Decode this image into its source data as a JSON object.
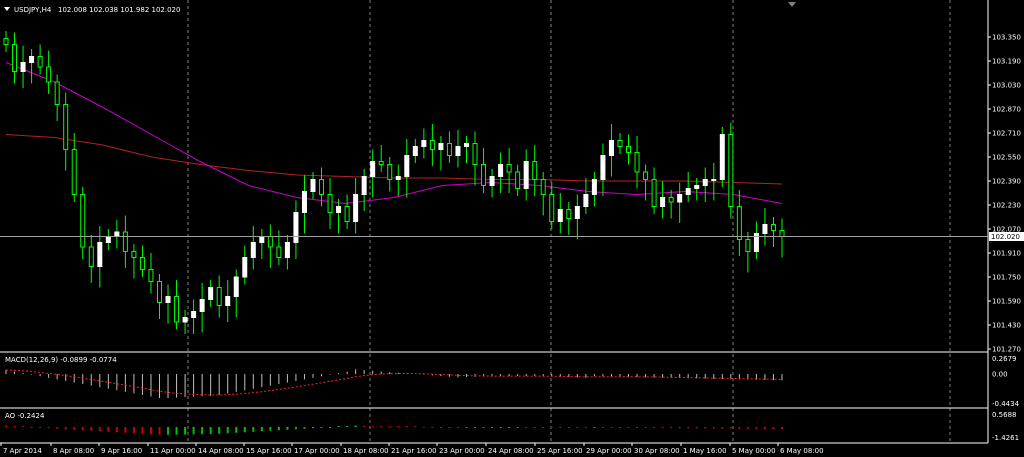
{
  "header": {
    "symbol_label": "USDJPY,H4",
    "ohlc": "102.008 102.038 101.982 102.020"
  },
  "price_panel": {
    "current_price_label": "102.020"
  },
  "macd_panel": {
    "label": "MACD(12,26,9) -0.0899 -0.0774"
  },
  "ao_panel": {
    "label": "AO -0.2424"
  },
  "colors": {
    "background": "#000000",
    "bull_candle": "#ffffff",
    "candle_wick": "#00ff00",
    "ma_fast": "#cc00cc",
    "ma_slow": "#b22222",
    "macd_hist": "#c0c0c0",
    "macd_signal": "#ff2020",
    "ao_up": "#00c000",
    "ao_down": "#d00000"
  },
  "chart_data": [
    {
      "type": "candlestick",
      "title": "USDJPY,H4",
      "y_ticks": [
        "103.350",
        "103.190",
        "103.030",
        "102.870",
        "102.710",
        "102.550",
        "102.390",
        "102.230",
        "102.070",
        "101.910",
        "101.750",
        "101.590",
        "101.430",
        "101.270"
      ],
      "x_ticks": [
        "7 Apr 2014",
        "8 Apr 08:00",
        "9 Apr 16:00",
        "11 Apr 00:00",
        "14 Apr 08:00",
        "15 Apr 16:00",
        "17 Apr 00:00",
        "18 Apr 08:00",
        "21 Apr 16:00",
        "23 Apr 00:00",
        "24 Apr 08:00",
        "25 Apr 16:00",
        "29 Apr 00:00",
        "30 Apr 08:00",
        "1 May 16:00",
        "5 May 00:00",
        "6 May 08:00"
      ],
      "ylim": [
        101.27,
        103.43
      ],
      "closes": [
        103.3,
        103.12,
        103.18,
        103.22,
        103.15,
        103.05,
        102.9,
        102.6,
        102.3,
        101.95,
        101.82,
        101.98,
        102.02,
        102.05,
        101.92,
        101.88,
        101.8,
        101.72,
        101.58,
        101.62,
        101.45,
        101.48,
        101.52,
        101.6,
        101.68,
        101.56,
        101.62,
        101.75,
        101.88,
        101.98,
        102.02,
        101.95,
        101.88,
        101.98,
        102.18,
        102.32,
        102.4,
        102.3,
        102.18,
        102.22,
        102.12,
        102.3,
        102.42,
        102.52,
        102.5,
        102.4,
        102.42,
        102.56,
        102.62,
        102.66,
        102.6,
        102.64,
        102.56,
        102.62,
        102.64,
        102.5,
        102.36,
        102.42,
        102.5,
        102.45,
        102.34,
        102.52,
        102.4,
        102.3,
        102.12,
        102.2,
        102.14,
        102.22,
        102.3,
        102.4,
        102.56,
        102.66,
        102.62,
        102.58,
        102.45,
        102.4,
        102.22,
        102.28,
        102.25,
        102.3,
        102.34,
        102.36,
        102.4,
        102.4,
        102.7,
        102.22,
        102.0,
        101.92,
        102.04,
        102.1,
        102.06,
        102.02
      ],
      "last_price": 102.02,
      "ma_fast": [
        103.18,
        103.05,
        102.88,
        102.7,
        102.52,
        102.36,
        102.28,
        102.24,
        102.28,
        102.36,
        102.38,
        102.36,
        102.32,
        102.3,
        102.32,
        102.3,
        102.24
      ],
      "ma_slow": [
        102.7,
        102.68,
        102.63,
        102.55,
        102.5,
        102.46,
        102.43,
        102.42,
        102.41,
        102.41,
        102.4,
        102.4,
        102.39,
        102.39,
        102.39,
        102.38,
        102.37
      ]
    },
    {
      "type": "macd",
      "title": "MACD(12,26,9) -0.0899 -0.0774",
      "y_ticks": [
        "0.2679",
        "0.00",
        "-0.4434"
      ],
      "ylim": [
        -0.4434,
        0.2679
      ],
      "values": {
        "macd": -0.0899,
        "signal": -0.0774
      }
    },
    {
      "type": "ao",
      "title": "AO -0.2424",
      "y_ticks": [
        "0.5688",
        "-1.4261"
      ],
      "ylim": [
        -1.4261,
        0.5688
      ],
      "value": -0.2424
    }
  ]
}
